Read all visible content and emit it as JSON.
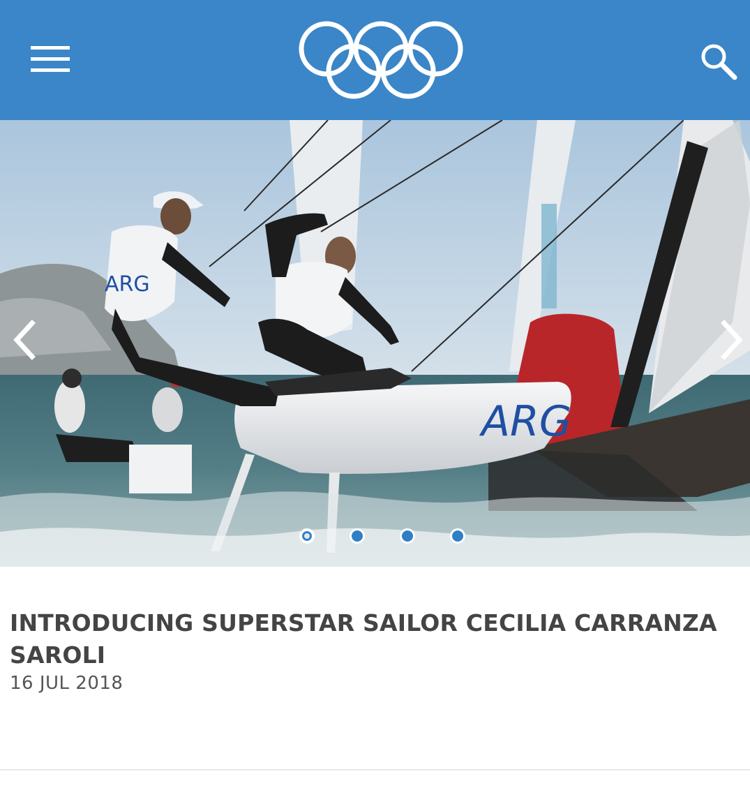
{
  "header": {
    "background_color": "#3a86c8",
    "menu_icon": "hamburger-menu-icon",
    "logo": "olympic-rings-logo",
    "search_icon": "search-icon"
  },
  "carousel": {
    "prev_icon": "chevron-left-icon",
    "next_icon": "chevron-right-icon",
    "slide_count": 4,
    "active_index": 0,
    "image_text": {
      "hull_text": "ARG",
      "vest_text": "ARG"
    }
  },
  "article": {
    "title": "INTRODUCING SUPERSTAR SAILOR CECILIA CARRANZA SAROLI",
    "date": "16 JUL 2018"
  }
}
